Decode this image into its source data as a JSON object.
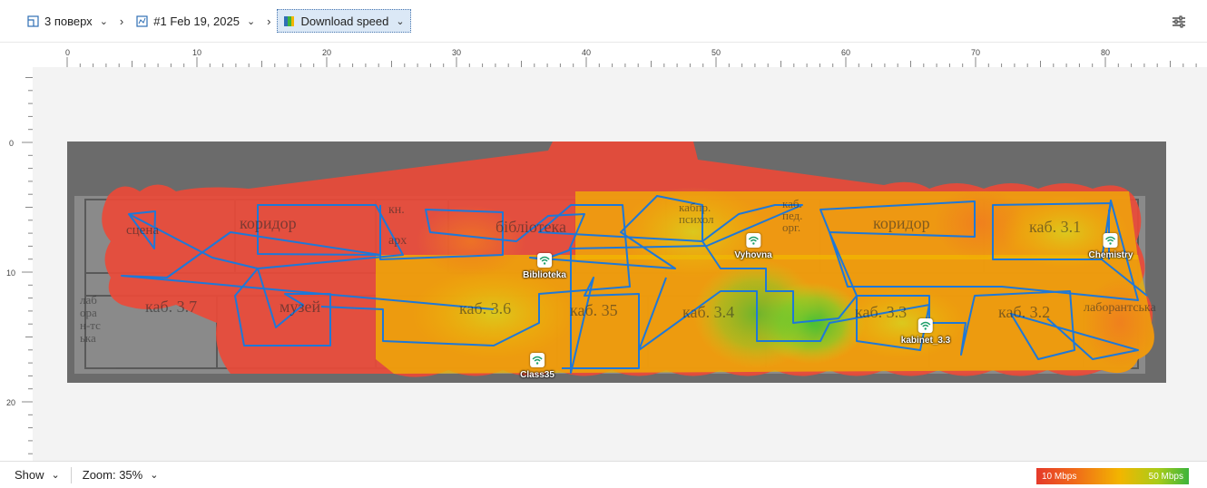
{
  "breadcrumb": {
    "floor": "3 поверх",
    "survey": "#1 Feb 19, 2025",
    "metric": "Download speed"
  },
  "ruler": {
    "x_ticks": [
      "0",
      "10",
      "20",
      "30",
      "40",
      "50",
      "60",
      "70",
      "80"
    ],
    "y_ticks": [
      "0",
      "10",
      "20"
    ]
  },
  "floorplan_labels": {
    "corridor_left": "коридор",
    "archive_1": "кн.",
    "archive_2": "арх",
    "library": "бібліотека",
    "corridor_right": "коридор",
    "room_31": "каб. 3.1",
    "room_37": "каб. 3.7",
    "museum": "музей",
    "room_36": "каб. 3.6",
    "room_35": "каб. 35",
    "room_34": "каб. 3.4",
    "room_33": "каб. 3.3",
    "room_32": "каб. 3.2",
    "lab_left": "лаборан-тська",
    "lab_right": "лаборантська",
    "stage": "сцена",
    "psych": "кабпр. психол",
    "org": "каб. пед. орг."
  },
  "access_points": [
    {
      "name": "Biblioteka"
    },
    {
      "name": "Vyhovna"
    },
    {
      "name": "Chemistry"
    },
    {
      "name": "Class35"
    },
    {
      "name": "kabinet_3.3"
    }
  ],
  "bottom": {
    "show_label": "Show",
    "zoom_label": "Zoom: 35%"
  },
  "legend": {
    "min_label": "10 Mbps",
    "max_label": "50 Mbps",
    "colors": [
      "#e53a2a",
      "#f2b600",
      "#3cb43c"
    ]
  }
}
